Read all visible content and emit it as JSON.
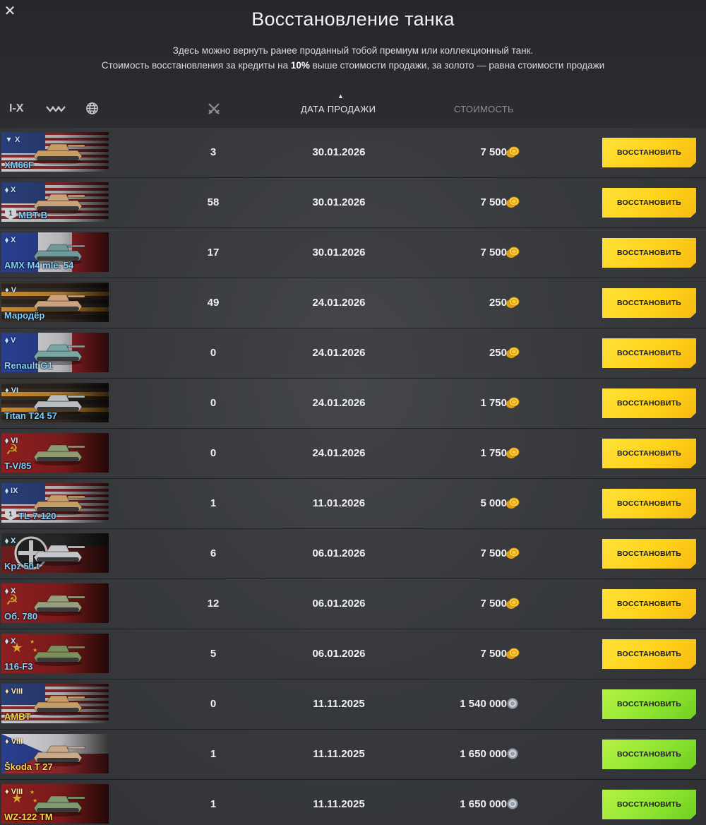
{
  "header": {
    "close_label": "✕",
    "title": "Восстановление танка",
    "subtitle_line1": "Здесь можно вернуть ранее проданный тобой премиум или коллекционный танк.",
    "subtitle_line2_a": "Стоимость восстановления за кредиты на ",
    "subtitle_line2_bold": "10%",
    "subtitle_line2_b": " выше стоимости продажи, за золото — равна стоимости продажи"
  },
  "filters": {
    "tier_filter": "I-X",
    "class_filter_icon": "tank-class-icon",
    "nation_filter_icon": "globe-icon",
    "battles_column_icon": "crossed-swords-icon"
  },
  "columns": {
    "date_label": "ДАТА ПРОДАЖИ",
    "cost_label": "СТОИМОСТЬ",
    "sort_arrow": "▲"
  },
  "colors": {
    "gold_button": "#ffd21a",
    "credit_button": "#8fe531",
    "premium_name": "#7fd2ff",
    "collector_name": "#ffd44a"
  },
  "rows": [
    {
      "tier": "X",
      "tier_prefix": "▼",
      "name": "XM66F",
      "nation": "usa",
      "mastery": "",
      "battles": "3",
      "date": "30.01.2026",
      "price": "7 500",
      "currency": "gold",
      "button": "ВОССТАНОВИТЬ",
      "tank_color": "#c79d66"
    },
    {
      "tier": "X",
      "tier_prefix": "⬧",
      "name": "MBT-B",
      "nation": "usa",
      "mastery": "1",
      "battles": "58",
      "date": "30.01.2026",
      "price": "7 500",
      "currency": "gold",
      "button": "ВОССТАНОВИТЬ",
      "tank_color": "#c9a27a"
    },
    {
      "tier": "X",
      "tier_prefix": "⬧",
      "name": "AMX M4 mle. 54",
      "nation": "france",
      "mastery": "",
      "battles": "17",
      "date": "30.01.2026",
      "price": "7 500",
      "currency": "gold",
      "button": "ВОССТАНОВИТЬ",
      "tank_color": "#6f9a99"
    },
    {
      "tier": "V",
      "tier_prefix": "♦",
      "name": "Мародёр",
      "nation": "stgeorge",
      "mastery": "",
      "battles": "49",
      "date": "24.01.2026",
      "price": "250",
      "currency": "gold",
      "button": "ВОССТАНОВИТЬ",
      "tank_color": "#cda27a"
    },
    {
      "tier": "V",
      "tier_prefix": "⬧",
      "name": "Renault G1",
      "nation": "france",
      "mastery": "",
      "battles": "0",
      "date": "24.01.2026",
      "price": "250",
      "currency": "gold",
      "button": "ВОССТАНОВИТЬ",
      "tank_color": "#7aa6a4"
    },
    {
      "tier": "VI",
      "tier_prefix": "♦",
      "name": "Titan T24 57",
      "nation": "stgeorge",
      "mastery": "",
      "battles": "0",
      "date": "24.01.2026",
      "price": "1 750",
      "currency": "gold",
      "button": "ВОССТАНОВИТЬ",
      "tank_color": "#b9bcc0"
    },
    {
      "tier": "VI",
      "tier_prefix": "⬧",
      "name": "T-V/85",
      "nation": "ussr",
      "mastery": "",
      "battles": "0",
      "date": "24.01.2026",
      "price": "1 750",
      "currency": "gold",
      "button": "ВОССТАНОВИТЬ",
      "tank_color": "#8d9a72"
    },
    {
      "tier": "IX",
      "tier_prefix": "⬧",
      "name": "TL-7-120",
      "nation": "usa",
      "mastery": "1",
      "battles": "1",
      "date": "11.01.2026",
      "price": "5 000",
      "currency": "gold",
      "button": "ВОССТАНОВИТЬ",
      "tank_color": "#c79d66"
    },
    {
      "tier": "X",
      "tier_prefix": "⬧",
      "name": "Kpz 50 t",
      "nation": "germany",
      "mastery": "",
      "battles": "6",
      "date": "06.01.2026",
      "price": "7 500",
      "currency": "gold",
      "button": "ВОССТАНОВИТЬ",
      "tank_color": "#c4c6cc"
    },
    {
      "tier": "X",
      "tier_prefix": "⬧",
      "name": "Об. 780",
      "nation": "ussr",
      "mastery": "",
      "battles": "12",
      "date": "06.01.2026",
      "price": "7 500",
      "currency": "gold",
      "button": "ВОССТАНОВИТЬ",
      "tank_color": "#97a07a"
    },
    {
      "tier": "X",
      "tier_prefix": "⬧",
      "name": "116-F3",
      "nation": "china",
      "mastery": "",
      "battles": "5",
      "date": "06.01.2026",
      "price": "7 500",
      "currency": "gold",
      "button": "ВОССТАНОВИТЬ",
      "tank_color": "#7e8f5e"
    },
    {
      "tier": "VIII",
      "tier_prefix": "♦",
      "name": "AMBT",
      "nation": "usa",
      "mastery": "",
      "battles": "0",
      "date": "11.11.2025",
      "price": "1 540 000",
      "currency": "credits",
      "button": "ВОССТАНОВИТЬ",
      "tank_color": "#c79d66"
    },
    {
      "tier": "VIII",
      "tier_prefix": "♦",
      "name": "Škoda T 27",
      "nation": "czech",
      "mastery": "",
      "battles": "1",
      "date": "11.11.2025",
      "price": "1 650 000",
      "currency": "credits",
      "button": "ВОССТАНОВИТЬ",
      "tank_color": "#c9a98a"
    },
    {
      "tier": "VIII",
      "tier_prefix": "♦",
      "name": "WZ-122 TM",
      "nation": "china",
      "mastery": "",
      "battles": "1",
      "date": "11.11.2025",
      "price": "1 650 000",
      "currency": "credits",
      "button": "ВОССТАНОВИТЬ",
      "tank_color": "#7e9a6e"
    }
  ]
}
